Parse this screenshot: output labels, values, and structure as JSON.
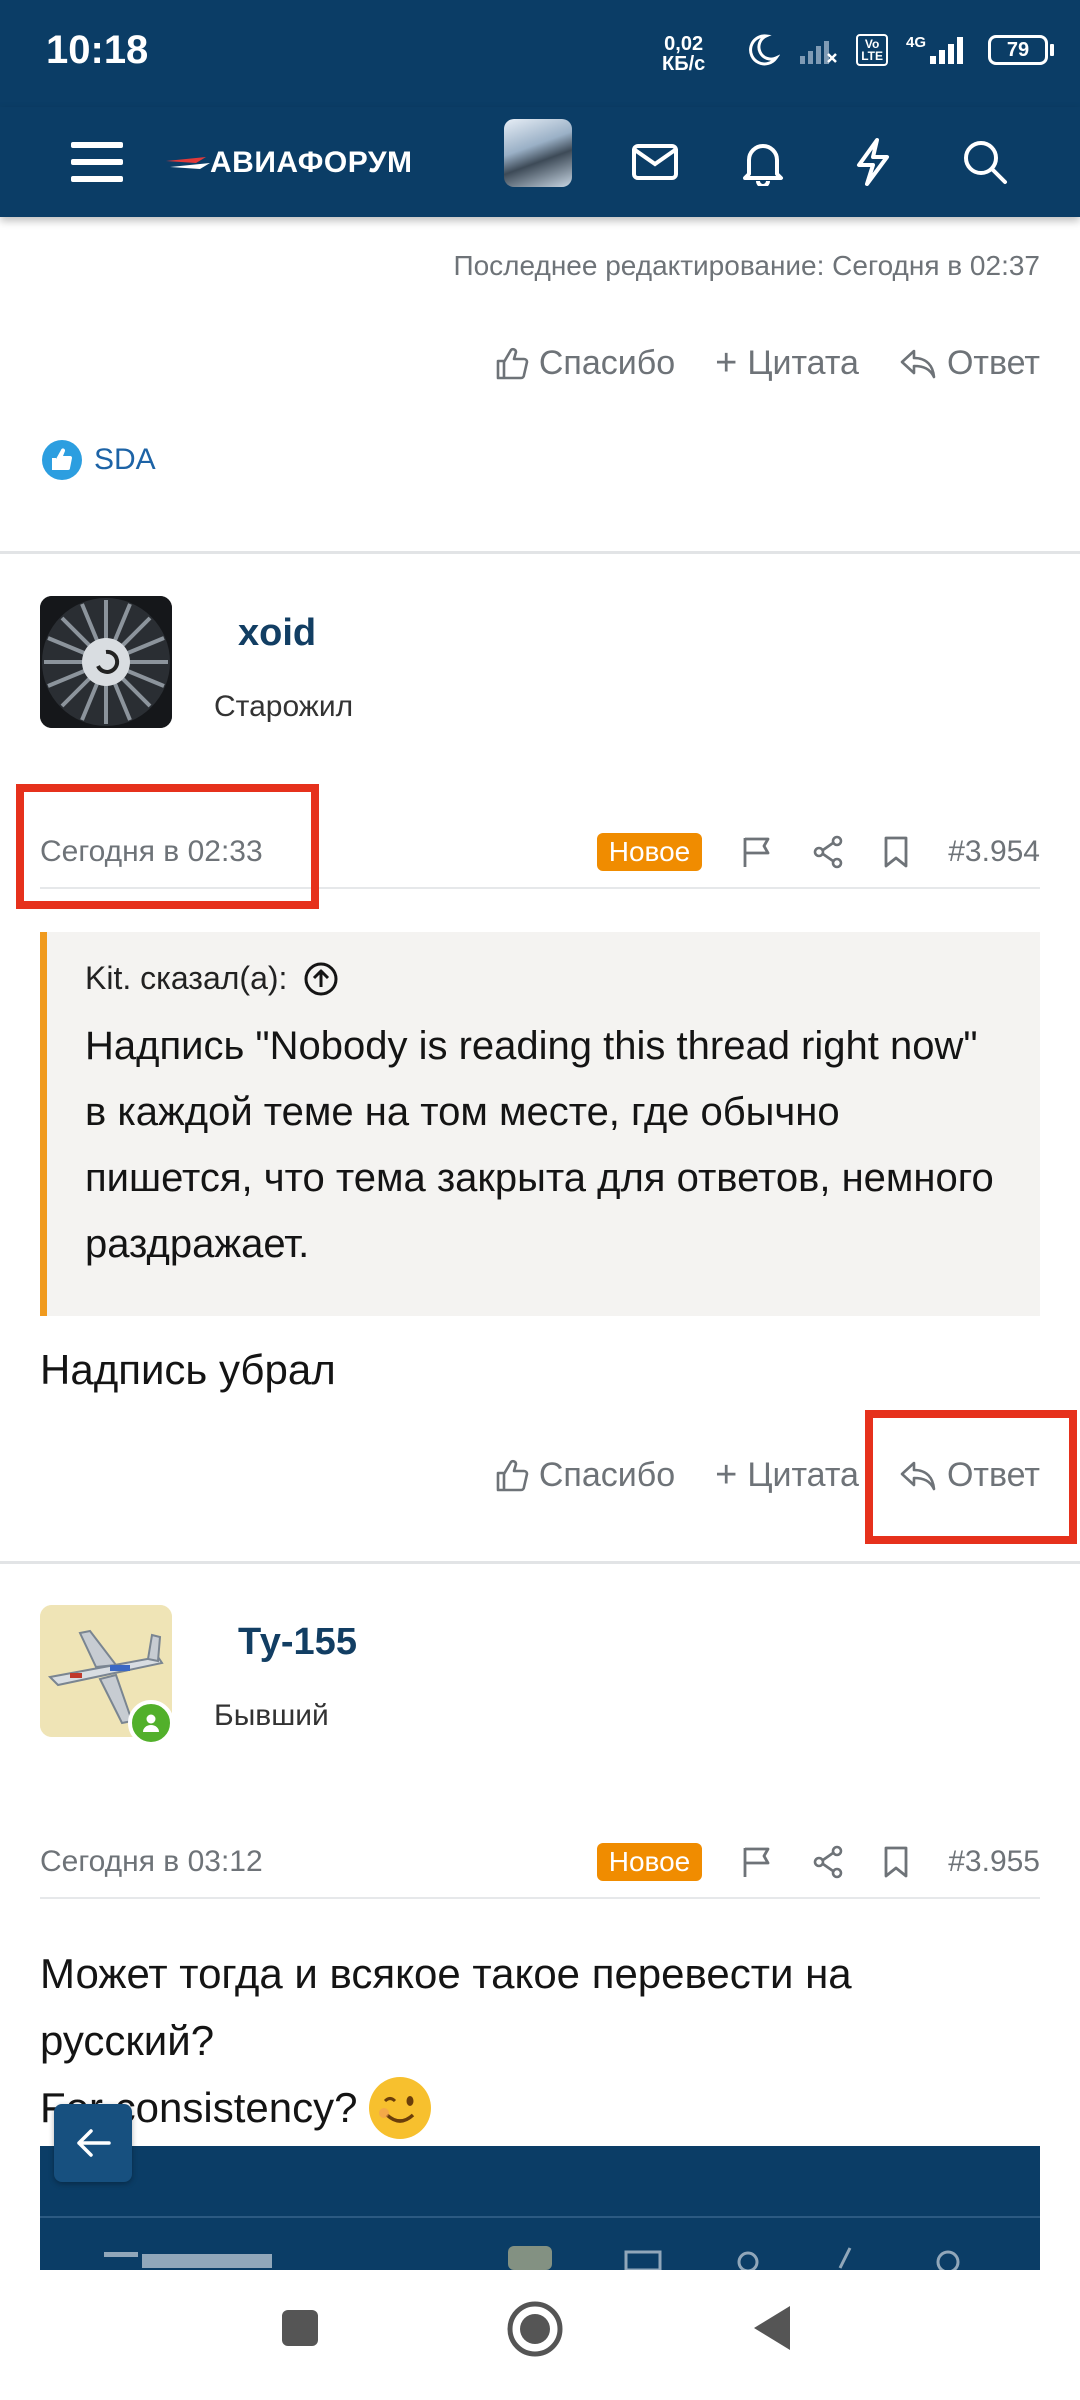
{
  "status_bar": {
    "time": "10:18",
    "net_speed_value": "0,02",
    "net_speed_unit": "КБ/с",
    "volte_top": "Vo",
    "volte_bottom": "LTE",
    "net_type": "4G",
    "battery": "79"
  },
  "nav": {
    "logo_text": "АВИАФОРУМ",
    "icons": [
      "menu-icon",
      "mail-icon",
      "bell-icon",
      "bolt-icon",
      "search-icon"
    ]
  },
  "prev_post": {
    "edited": "Последнее редактирование: Сегодня в 02:37",
    "reactions_user": "SDA"
  },
  "actions": {
    "thanks": "Спасибо",
    "quote": "Цитата",
    "reply": "Ответ"
  },
  "post1": {
    "username": "xoid",
    "user_title": "Старожил",
    "date": "Сегодня в 02:33",
    "badge": "Новое",
    "number": "#3.954",
    "quote_author": "Kit. сказал(а):",
    "quote_text": "Надпись \"Nobody is reading this thread right now\" в каждой теме на том месте, где обычно пишется, что тема закрыта для ответов, немного раздражает.",
    "text": "Надпись убрал"
  },
  "post2": {
    "username": "Ту-155",
    "user_title": "Бывший",
    "date": "Сегодня в 03:12",
    "badge": "Новое",
    "number": "#3.955",
    "text_line1": "Может тогда и всякое такое перевести на",
    "text_line2": "русский?",
    "text_line3": "For consistency?"
  },
  "colors": {
    "header_bg": "#0b3d66",
    "accent_orange": "#f08c00",
    "quote_border": "#f09a1e",
    "highlight_red": "#e6311c",
    "username_blue": "#123e63"
  }
}
